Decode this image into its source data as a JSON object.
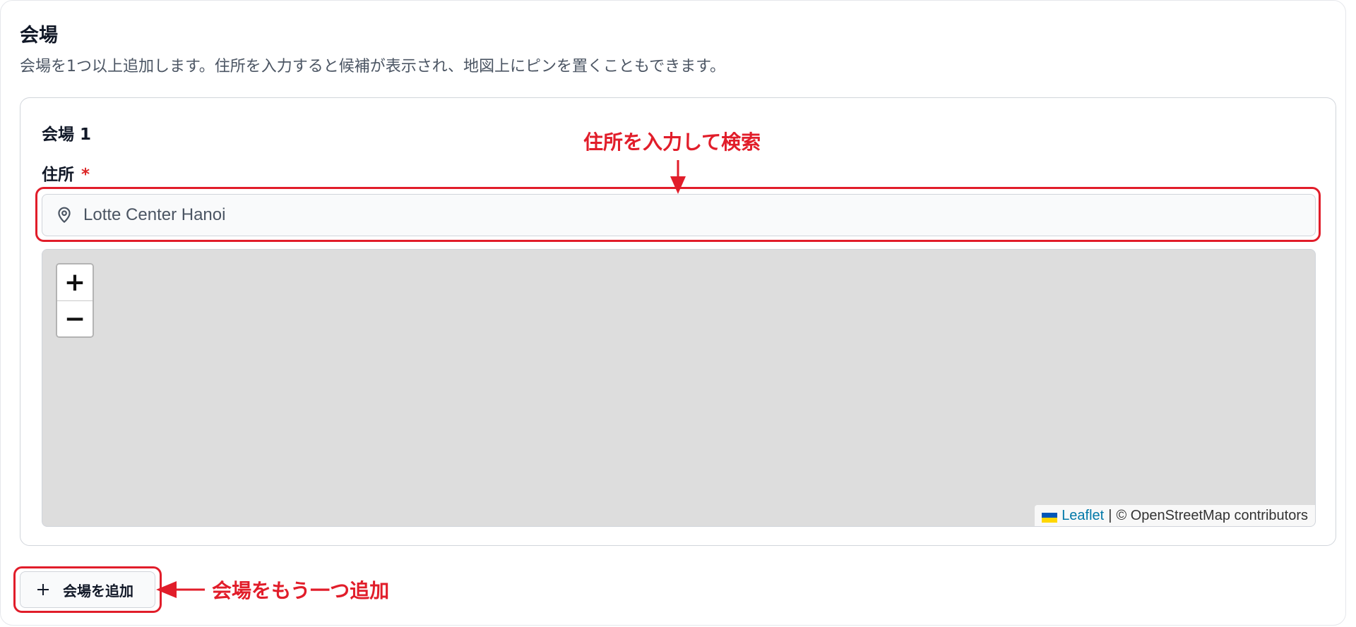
{
  "section": {
    "title": "会場",
    "description": "会場を1つ以上追加します。住所を入力すると候補が表示され、地図上にピンを置くこともできます。"
  },
  "venue": {
    "heading": "会場 1",
    "address_label": "住所",
    "required_mark": "*",
    "address_value": "Lotte Center Hanoi",
    "pin_icon": "map-pin-icon"
  },
  "map": {
    "zoom_in": "+",
    "zoom_out": "−",
    "attribution_link": "Leaflet",
    "attribution_separator": "|",
    "attribution_text": "© OpenStreetMap contributors",
    "flag_icon": "ukraine-flag-icon"
  },
  "add_button": {
    "icon": "plus-icon",
    "label": "会場を追加"
  },
  "annotations": {
    "search_hint": "住所を入力して検索",
    "add_hint": "会場をもう一つ追加",
    "color": "#e11d2a"
  }
}
